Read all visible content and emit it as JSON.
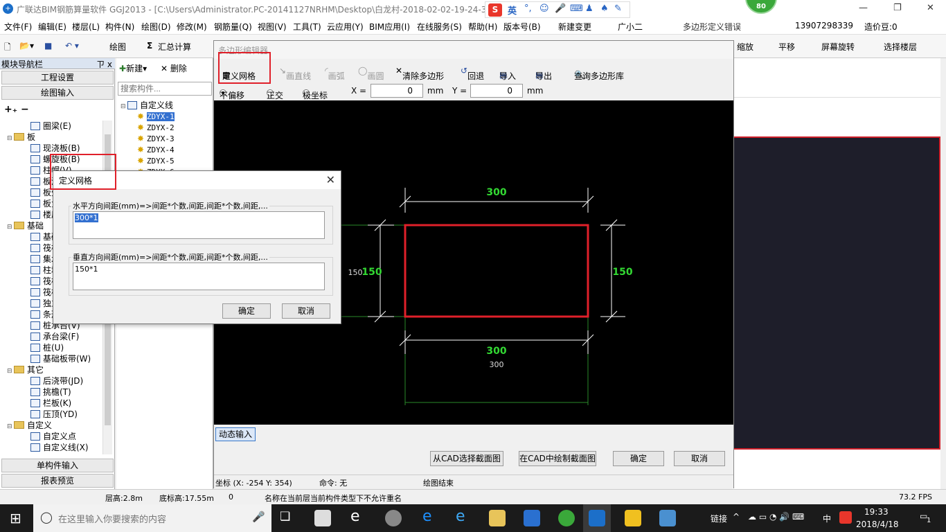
{
  "app": {
    "title": "广联达BIM钢筋算量软件 GGJ2013 - [C:\\Users\\Administrator.PC-20141127NRHM\\Desktop\\白龙村-2018-02-02-19-24-35",
    "score": "80",
    "ime_label": "英",
    "notice": "多边形定义错误"
  },
  "menu": [
    "文件(F)",
    "编辑(E)",
    "楼层(L)",
    "构件(N)",
    "绘图(D)",
    "修改(M)",
    "钢筋量(Q)",
    "视图(V)",
    "工具(T)",
    "云应用(Y)",
    "BIM应用(I)",
    "在线服务(S)",
    "帮助(H)",
    "版本号(B)",
    "新建变更",
    "广小二"
  ],
  "account": {
    "phone": "13907298339",
    "price": "造价豆:0"
  },
  "toolbar": {
    "draw": "绘图",
    "sum": "汇总计算",
    "zoom": "缩放",
    "pan": "平移",
    "rotate": "屏幕旋转",
    "floor": "选择楼层"
  },
  "nav": {
    "title": "模块导航栏",
    "pin": "ㄗ x",
    "btn_project": "工程设置",
    "btn_draw": "绘图输入",
    "btn_single": "单构件输入",
    "btn_report": "报表预览",
    "items": [
      {
        "label": "圈梁(E)",
        "level": 2
      },
      {
        "label": "板",
        "level": 1
      },
      {
        "label": "现浇板(B)",
        "level": 2
      },
      {
        "label": "螺旋板(B)",
        "level": 2
      },
      {
        "label": "柱帽(V)",
        "level": 2
      },
      {
        "label": "板洞(N)",
        "level": 2
      },
      {
        "label": "板受力筋(S)",
        "level": 2
      },
      {
        "label": "板负筋(F)",
        "level": 2
      },
      {
        "label": "楼层板带(H)",
        "level": 2
      },
      {
        "label": "基础",
        "level": 1
      },
      {
        "label": "基础梁(F)",
        "level": 2
      },
      {
        "label": "筏板基础(M)",
        "level": 2
      },
      {
        "label": "集水坑(K)",
        "level": 2
      },
      {
        "label": "柱墩(Y)",
        "level": 2
      },
      {
        "label": "筏板主筋(R)",
        "level": 2
      },
      {
        "label": "筏板负筋(X)",
        "level": 2
      },
      {
        "label": "独立基础(P)",
        "level": 2
      },
      {
        "label": "条形基础(T)",
        "level": 2
      },
      {
        "label": "桩承台(V)",
        "level": 2
      },
      {
        "label": "承台梁(F)",
        "level": 2
      },
      {
        "label": "桩(U)",
        "level": 2
      },
      {
        "label": "基础板带(W)",
        "level": 2
      },
      {
        "label": "其它",
        "level": 1
      },
      {
        "label": "后浇带(JD)",
        "level": 2
      },
      {
        "label": "挑檐(T)",
        "level": 2
      },
      {
        "label": "栏板(K)",
        "level": 2
      },
      {
        "label": "压顶(YD)",
        "level": 2
      },
      {
        "label": "自定义",
        "level": 1
      },
      {
        "label": "自定义点",
        "level": 2
      },
      {
        "label": "自定义线(X)",
        "level": 2
      }
    ]
  },
  "components": {
    "new": "新建",
    "delete": "删除",
    "search_placeholder": "搜索构件...",
    "root": "自定义线",
    "items": [
      "ZDYX-1",
      "ZDYX-2",
      "ZDYX-3",
      "ZDYX-4",
      "ZDYX-5",
      "ZDYX-6"
    ]
  },
  "editor": {
    "title": "多边形编辑器",
    "tools": {
      "grid": "定义网格",
      "line": "画直线",
      "arc": "画弧",
      "circle": "画圆",
      "clear": "清除多边形",
      "undo": "回退",
      "import": "导入",
      "export": "导出",
      "library": "查询多边形库"
    },
    "opts": {
      "no_offset": "不偏移",
      "ortho": "正交",
      "polar": "极坐标",
      "x_label": "X =",
      "x_val": "0",
      "y_label": "Y =",
      "y_val": "0",
      "unit": "mm"
    },
    "dims": {
      "top": "300",
      "bottom": "300",
      "bottom_sub": "300",
      "left": "150",
      "left_sub": "150",
      "right": "150"
    },
    "dyn_input": "动态输入",
    "btn_cad_select": "从CAD选择截面图",
    "btn_cad_draw": "在CAD中绘制截面图",
    "btn_ok": "确定",
    "btn_cancel": "取消",
    "status": {
      "coord": "坐标 (X: -254 Y: 354)",
      "cmd": "命令: 无",
      "msg": "绘图结束"
    }
  },
  "dialog": {
    "title": "定义网格",
    "h_label": "水平方向间距(mm)=>间距*个数,间距,间距*个数,间距,...",
    "h_value": "300*1",
    "v_label": "垂直方向间距(mm)=>间距*个数,间距,间距*个数,间距,...",
    "v_value": "150*1",
    "ok": "确定",
    "cancel": "取消"
  },
  "statusbar": {
    "floor_h": "层高:2.8m",
    "base_h": "底标高:17.55m",
    "zero": "0",
    "msg": "名称在当前层当前构件类型下不允许重名",
    "fps": "73.2 FPS"
  },
  "taskbar": {
    "search": "在这里输入你要搜索的内容",
    "link": "链接",
    "lang": "中",
    "time": "19:33",
    "date": "2018/4/18",
    "notif": "1"
  },
  "colors": {
    "accent_red": "#e0202a",
    "dim_green": "#33d933",
    "canvas_bg": "#000000"
  }
}
